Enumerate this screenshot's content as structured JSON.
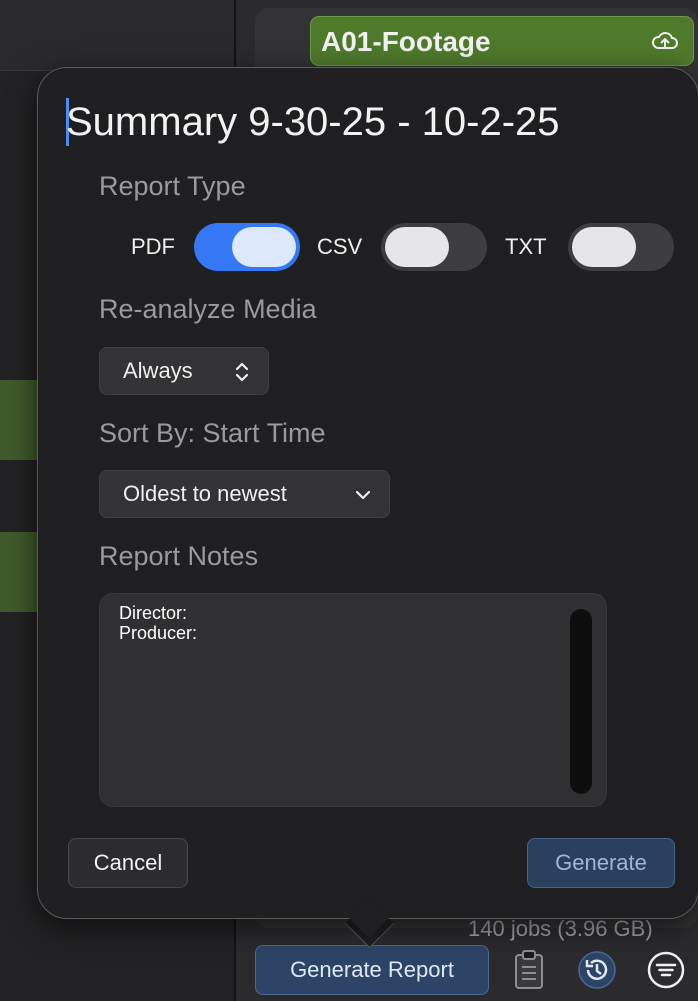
{
  "background": {
    "tag_title": "A01-Footage",
    "tag_icon": "cloud-upload-icon",
    "jobs_count": "140 jobs (3.96 GB)",
    "generate_report_label": "Generate Report",
    "bottom_icons": [
      "clipboard-icon",
      "history-icon",
      "filter-icon"
    ]
  },
  "dialog": {
    "title": "Summary 9-30-25 - 10-2-25",
    "report_type_label": "Report Type",
    "formats": [
      {
        "label": "PDF",
        "on": true
      },
      {
        "label": "CSV",
        "on": false
      },
      {
        "label": "TXT",
        "on": false
      }
    ],
    "reanalyze_label": "Re-analyze Media",
    "reanalyze_value": "Always",
    "sort_label": "Sort By: Start Time",
    "sort_value": "Oldest to newest",
    "notes_label": "Report Notes",
    "notes_text": "Director:\nProducer:",
    "cancel_label": "Cancel",
    "generate_label": "Generate"
  },
  "colors": {
    "accent": "#3478f6",
    "tag_green": "#4f7a2c"
  }
}
